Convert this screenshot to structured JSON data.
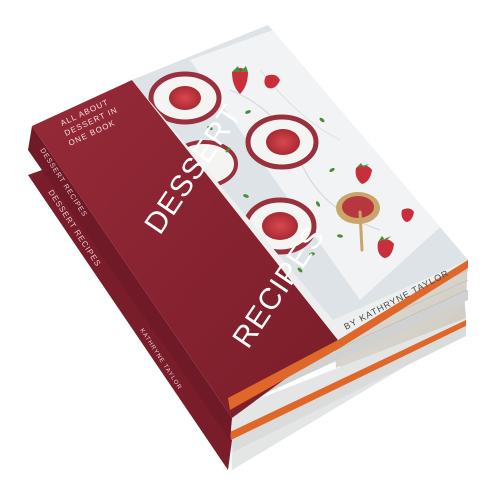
{
  "cover": {
    "tagline_lines": [
      "ALL ABOUT",
      "DESSERT IN",
      "ONE BOOK"
    ],
    "title_line1": "DESSERT",
    "title_line2": "RECIPES",
    "author": "BY KATHRYNE TAYLOR"
  },
  "spine": {
    "title": "DESSERT RECIPES",
    "author": "KATHRYNE TAYLOR"
  },
  "colors": {
    "maroon": "#8a2331",
    "maroon_dark": "#5e1520",
    "orange_stripe": "#e0672a",
    "cover_white": "#ecefee",
    "page_edge": "#d9d6cf",
    "photo_bg": "#dfe4e6",
    "bowl_rim": "#9a2f3e",
    "jam": "#c93a43",
    "mint": "#4d8a3a"
  }
}
